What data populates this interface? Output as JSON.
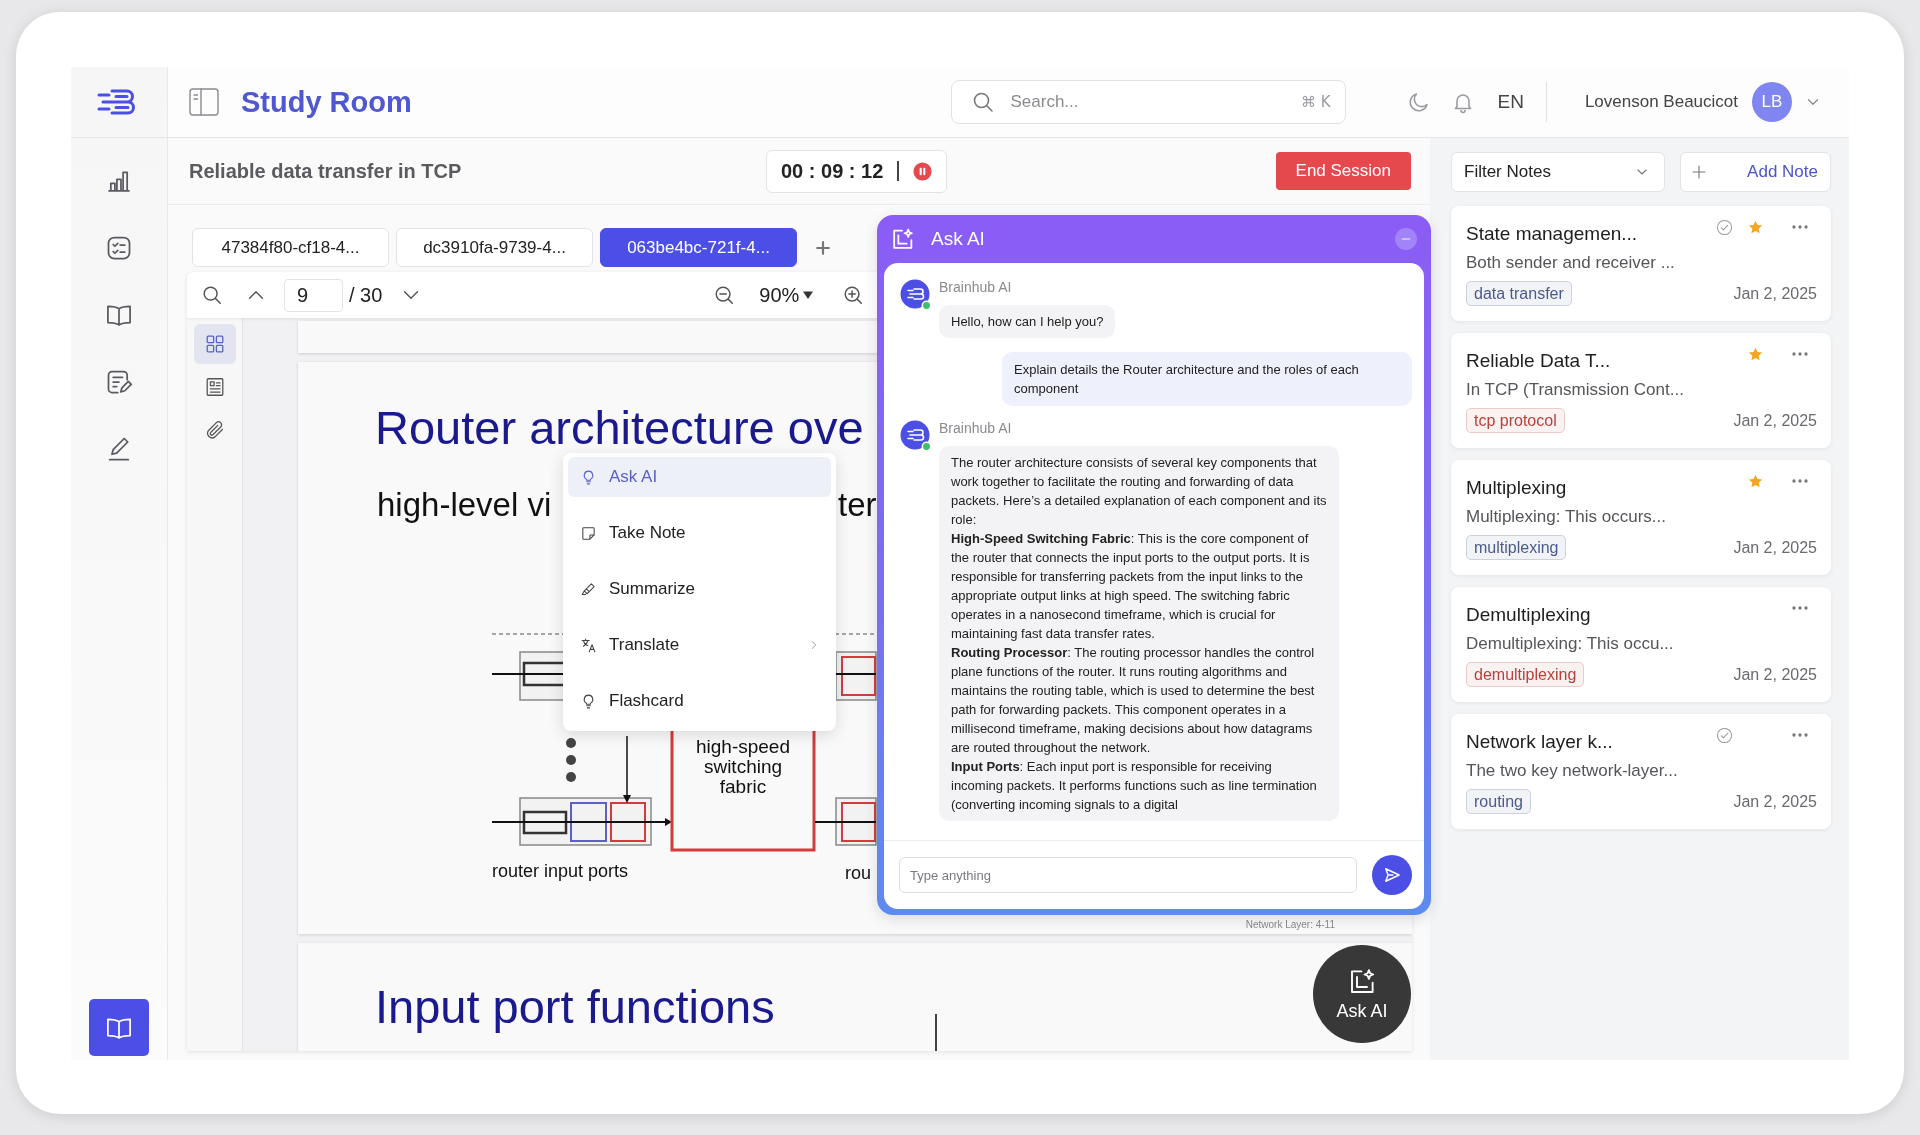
{
  "header": {
    "title": "Study Room",
    "search": {
      "placeholder": "Search...",
      "shortcut": "⌘ K"
    },
    "language": "EN",
    "user": {
      "name": "Lovenson Beaucicot",
      "initials": "LB"
    }
  },
  "sidebar": {
    "items": [
      {
        "selected": false
      },
      {
        "selected": false
      },
      {
        "selected": false
      },
      {
        "selected": false
      },
      {
        "selected": false
      },
      {
        "selected": true
      }
    ]
  },
  "session": {
    "title": "Reliable data transfer in TCP",
    "timer": "00 : 09 : 12",
    "end_button": "End Session"
  },
  "documents": {
    "tabs": [
      {
        "label": "47384f80-cf18-4...",
        "selected": false
      },
      {
        "label": "dc3910fa-9739-4...",
        "selected": false
      },
      {
        "label": "063be4bc-721f-4...",
        "selected": true
      }
    ],
    "toolbar": {
      "page": "9",
      "page_total": "/ 30",
      "zoom": "90%"
    },
    "side_tools": [
      {
        "selected": true
      },
      {
        "selected": false
      },
      {
        "selected": false
      }
    ],
    "pages": [
      {
        "kind": "blank"
      },
      {
        "kind": "slide",
        "title": "Router architecture ove",
        "subtitle": [
          "high-level vi",
          "ter"
        ],
        "diagram": {
          "fabric_label": [
            "high-speed",
            "switching",
            "fabric"
          ],
          "input_label": "router input ports",
          "output_label": "rou"
        },
        "footer": "Network Layer: 4-11"
      },
      {
        "kind": "slide",
        "title": "Input port functions"
      }
    ]
  },
  "context_menu": {
    "items": [
      {
        "label": "Ask AI",
        "selected": true,
        "submenu": false
      },
      {
        "label": "Take Note",
        "selected": false,
        "submenu": false
      },
      {
        "label": "Summarize",
        "selected": false,
        "submenu": false
      },
      {
        "label": "Translate",
        "selected": false,
        "submenu": true
      },
      {
        "label": "Flashcard",
        "selected": false,
        "submenu": false
      }
    ]
  },
  "ask_ai": {
    "title": "Ask AI",
    "messages": [
      {
        "kind": "bot",
        "sender": "Brainhub AI",
        "paragraphs": [
          "Hello, how can I help you?"
        ]
      },
      {
        "kind": "user",
        "paragraphs": [
          "Explain details the Router architecture and the roles of each component"
        ]
      },
      {
        "kind": "bot",
        "sender": "Brainhub AI",
        "paragraphs": [
          "The router architecture consists of several key components that work together to facilitate the routing and forwarding of data packets. Here’s a detailed explanation of each component and its role:",
          "**High-Speed Switching Fabric**: This is the core component of the router that connects the input ports to the output ports. It is responsible for transferring packets from the input links to the appropriate output links at high speed. The switching fabric operates in a nanosecond timeframe, which is crucial for maintaining fast data transfer rates.",
          "**Routing Processor**: The routing processor handles the control plane functions of the router. It runs routing algorithms and maintains the routing table, which is used to determine the best path for forwarding packets. This component operates in a millisecond timeframe, making decisions about how datagrams are routed throughout the network.",
          "**Input Ports**: Each input port is responsible for receiving incoming packets. It performs functions such as line termination (converting incoming signals to a digital"
        ]
      }
    ],
    "input": {
      "placeholder": "Type anything"
    }
  },
  "ask_ai_button": {
    "label": "Ask AI"
  },
  "notes": {
    "filter": {
      "label": "Filter Notes"
    },
    "add_button": "Add Note",
    "items": [
      {
        "title": "State managemen...",
        "excerpt": "Both sender and receiver ...",
        "tag": {
          "label": "data transfer",
          "color": "#4a5a8c"
        },
        "date": "Jan 2, 2025",
        "done": true,
        "starred": true
      },
      {
        "title": "Reliable Data T...",
        "excerpt": "In TCP (Transmission Cont...",
        "tag": {
          "label": "tcp protocol",
          "color": "#b8403a"
        },
        "date": "Jan 2, 2025",
        "done": false,
        "starred": true
      },
      {
        "title": "Multiplexing",
        "excerpt": "Multiplexing: This occurs...",
        "tag": {
          "label": "multiplexing",
          "color": "#4a5a8c"
        },
        "date": "Jan 2, 2025",
        "done": false,
        "starred": true
      },
      {
        "title": "Demultiplexing",
        "excerpt": "Demultiplexing: This occu...",
        "tag": {
          "label": "demultiplexing",
          "color": "#b8403a"
        },
        "date": "Jan 2, 2025",
        "done": false,
        "starred": false
      },
      {
        "title": "Network layer k...",
        "excerpt": "The two key network-layer...",
        "tag": {
          "label": "routing",
          "color": "#4a5a8c"
        },
        "date": "Jan 2, 2025",
        "done": true,
        "starred": false
      }
    ]
  }
}
